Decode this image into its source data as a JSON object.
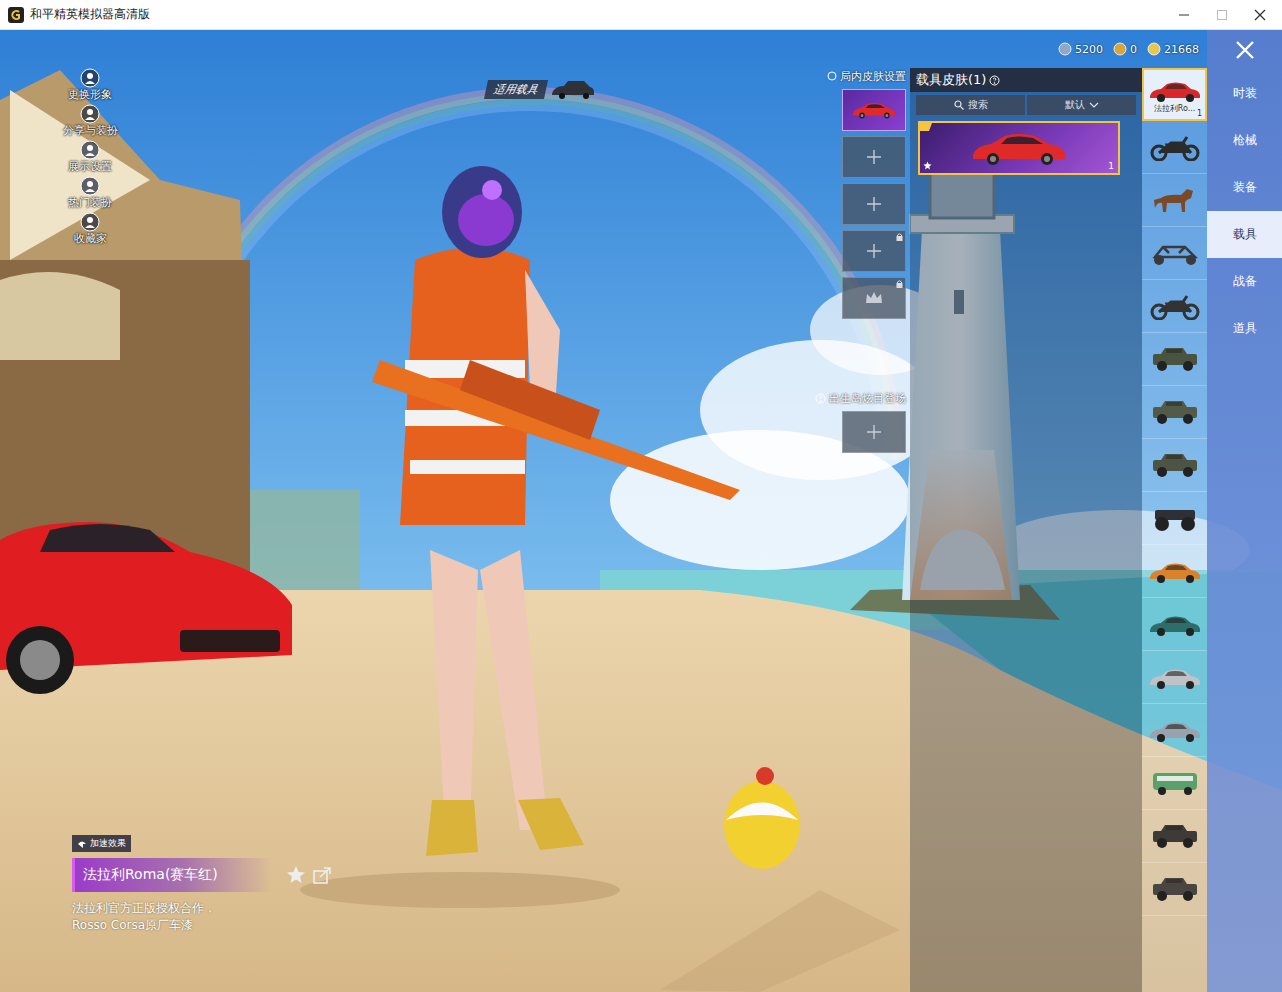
{
  "window": {
    "title": "和平精英模拟器高清版"
  },
  "left_menu": [
    {
      "label": "更换形象"
    },
    {
      "label": "分享与装扮"
    },
    {
      "label": "展示设置"
    },
    {
      "label": "热门装扮"
    },
    {
      "label": "收藏家"
    }
  ],
  "vehicle_tag": "适用载具",
  "currencies": [
    {
      "amount": "5200",
      "color": "#8fa8c8"
    },
    {
      "amount": "0",
      "color": "#d9a53a"
    },
    {
      "amount": "21668",
      "color": "#e8c84a"
    }
  ],
  "in_match_skin": {
    "title": "局内皮肤设置",
    "slots": [
      {
        "kind": "filled"
      },
      {
        "kind": "empty"
      },
      {
        "kind": "empty"
      },
      {
        "kind": "locked"
      },
      {
        "kind": "crown"
      }
    ]
  },
  "spawn_entrance": {
    "title": "出生岛炫目登场",
    "slots": [
      {
        "kind": "empty"
      }
    ]
  },
  "skin_panel": {
    "title": "载具皮肤(1)",
    "search": "搜索",
    "sort": "默认",
    "cards": [
      {
        "selected": true,
        "count": "1"
      }
    ]
  },
  "vehicles": [
    {
      "label": "法拉利Ro...",
      "count": "1",
      "selected": true,
      "kind": "car",
      "color": "#d8282a"
    },
    {
      "label": "",
      "count": "",
      "selected": false,
      "kind": "motorcycle",
      "color": "#2b2b2b"
    },
    {
      "label": "",
      "count": "",
      "selected": false,
      "kind": "horse",
      "color": "#7a4a28"
    },
    {
      "label": "",
      "count": "",
      "selected": false,
      "kind": "buggy",
      "color": "#3a3a3a"
    },
    {
      "label": "",
      "count": "",
      "selected": false,
      "kind": "motorcycle",
      "color": "#333333"
    },
    {
      "label": "",
      "count": "",
      "selected": false,
      "kind": "jeep",
      "color": "#4a5240"
    },
    {
      "label": "",
      "count": "",
      "selected": false,
      "kind": "jeep",
      "color": "#545a48"
    },
    {
      "label": "",
      "count": "",
      "selected": false,
      "kind": "jeep",
      "color": "#4e5444"
    },
    {
      "label": "",
      "count": "",
      "selected": false,
      "kind": "truck",
      "color": "#2e3036"
    },
    {
      "label": "",
      "count": "",
      "selected": false,
      "kind": "car",
      "color": "#d9822b"
    },
    {
      "label": "",
      "count": "",
      "selected": false,
      "kind": "car",
      "color": "#2d6e6a"
    },
    {
      "label": "",
      "count": "",
      "selected": false,
      "kind": "car",
      "color": "#bfc3c8"
    },
    {
      "label": "",
      "count": "",
      "selected": false,
      "kind": "car",
      "color": "#9aa3ad"
    },
    {
      "label": "",
      "count": "",
      "selected": false,
      "kind": "van",
      "color": "#5aa06a"
    },
    {
      "label": "",
      "count": "",
      "selected": false,
      "kind": "jeep",
      "color": "#3e3a36"
    },
    {
      "label": "",
      "count": "",
      "selected": false,
      "kind": "jeep",
      "color": "#4a4540"
    }
  ],
  "tabs": [
    {
      "label": "时装",
      "selected": false
    },
    {
      "label": "枪械",
      "selected": false
    },
    {
      "label": "装备",
      "selected": false
    },
    {
      "label": "载具",
      "selected": true
    },
    {
      "label": "战备",
      "selected": false
    },
    {
      "label": "道具",
      "selected": false
    }
  ],
  "item": {
    "effect_badge": "加速效果",
    "name": "法拉利Roma(赛车红)",
    "description": "法拉利官方正版授权合作，Rosso Corsa原厂车漆"
  }
}
